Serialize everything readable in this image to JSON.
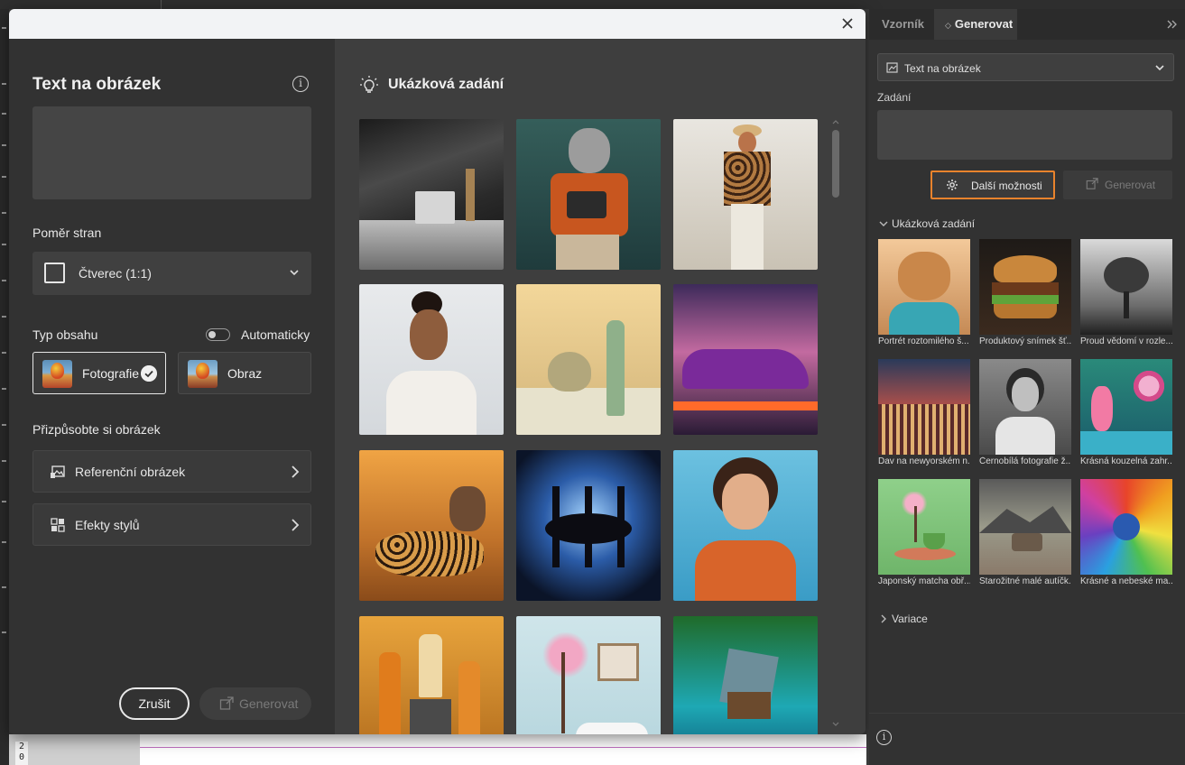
{
  "dialog": {
    "title": "Text na obrázek",
    "prompt_value": "",
    "aspect_label": "Poměr stran",
    "aspect_value": "Čtverec (1:1)",
    "content_type_label": "Typ obsahu",
    "auto_label": "Automaticky",
    "auto_on": false,
    "content_types": [
      {
        "label": "Fotografie",
        "selected": true
      },
      {
        "label": "Obraz",
        "selected": false
      }
    ],
    "customize_label": "Přizpůsobte si obrázek",
    "reference_label": "Referenční obrázek",
    "style_effects_label": "Efekty stylů",
    "cancel_label": "Zrušit",
    "generate_label": "Generovat",
    "gallery_title": "Ukázková zadání"
  },
  "panel": {
    "tabs": [
      "Vzorník",
      "Generovat"
    ],
    "active_tab": "Generovat",
    "mode_value": "Text na obrázek",
    "prompt_label": "Zadání",
    "prompt_value": "",
    "more_options_label": "Další možnosti",
    "generate_label": "Generovat",
    "samples_label": "Ukázková zadání",
    "variations_label": "Variace",
    "samples": [
      {
        "caption": "Portrét roztomilého š..."
      },
      {
        "caption": "Produktový snímek šť..."
      },
      {
        "caption": "Proud vědomí v rozle..."
      },
      {
        "caption": "Dav na newyorském n..."
      },
      {
        "caption": "Černobílá fotografie ž..."
      },
      {
        "caption": "Krásná kouzelná zahr..."
      },
      {
        "caption": "Japonský matcha obř..."
      },
      {
        "caption": "Starožitné malé autíčk..."
      },
      {
        "caption": "Krásné a nebeské ma..."
      }
    ]
  },
  "ruler": {
    "digits": [
      "2",
      "0"
    ]
  },
  "colors": {
    "accent_orange": "#e9832c",
    "dialog_header": "#f2f3f5"
  }
}
